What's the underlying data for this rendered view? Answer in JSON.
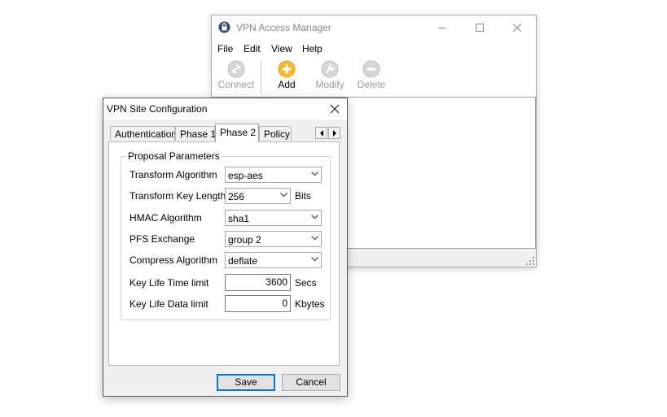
{
  "main_window": {
    "title": "VPN Access Manager",
    "menu": [
      "File",
      "Edit",
      "View",
      "Help"
    ],
    "toolbar": {
      "connect": "Connect",
      "add": "Add",
      "modify": "Modify",
      "delete": "Delete"
    },
    "icons": {
      "app": "app-icon",
      "minimize": "minimize-icon",
      "maximize": "maximize-icon",
      "close": "close-icon"
    },
    "colors": {
      "add_accent": "#f5b82e",
      "disabled": "#9a9a9a"
    }
  },
  "dialog": {
    "title": "VPN Site Configuration",
    "tabs": [
      "Authentication",
      "Phase 1",
      "Phase 2",
      "Policy"
    ],
    "active_tab": "Phase 2",
    "group_title": "Proposal Parameters",
    "fields": {
      "transform_algorithm": {
        "label": "Transform Algorithm",
        "value": "esp-aes"
      },
      "transform_key_length": {
        "label": "Transform Key Length",
        "value": "256",
        "unit": "Bits"
      },
      "hmac_algorithm": {
        "label": "HMAC Algorithm",
        "value": "sha1"
      },
      "pfs_exchange": {
        "label": "PFS Exchange",
        "value": "group 2"
      },
      "compress_algorithm": {
        "label": "Compress Algorithm",
        "value": "deflate"
      },
      "key_life_time": {
        "label": "Key Life Time limit",
        "value": "3600",
        "unit": "Secs"
      },
      "key_life_data": {
        "label": "Key Life Data limit",
        "value": "0",
        "unit": "Kbytes"
      }
    },
    "buttons": {
      "save": "Save",
      "cancel": "Cancel"
    },
    "colors": {
      "default_button_border": "#0078d7"
    }
  }
}
